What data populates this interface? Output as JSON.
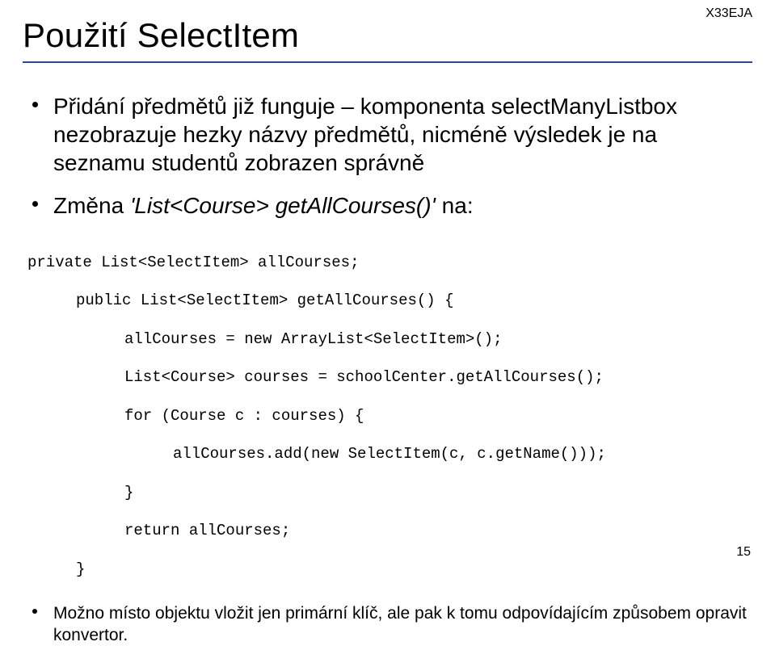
{
  "header": {
    "tag": "X33EJA"
  },
  "title": "Použití SelectItem",
  "bullets": [
    "Přidání předmětů již funguje – komponenta selectManyListbox nezobrazuje hezky názvy předmětů, nicméně výsledek je na seznamu studentů zobrazen správně",
    "Změna 'List<Course> getAllCourses()' na:"
  ],
  "change_label_prefix": "Změna ",
  "change_label_italic": "'List<Course> getAllCourses()'",
  "change_label_suffix": " na:",
  "code": {
    "l1": "private List<SelectItem> allCourses;",
    "l2": "public List<SelectItem> getAllCourses() {",
    "l3": "allCourses = new ArrayList<SelectItem>();",
    "l4": "List<Course> courses = schoolCenter.getAllCourses();",
    "l5": "for (Course c : courses) {",
    "l6": "allCourses.add(new SelectItem(c, c.getName()));",
    "l7": "}",
    "l8": "return allCourses;",
    "l9": "}"
  },
  "footer_bullet": "Možno místo objektu vložit jen primární klíč, ale pak k tomu odpovídajícím způsobem opravit konvertor.",
  "page_number": "15"
}
